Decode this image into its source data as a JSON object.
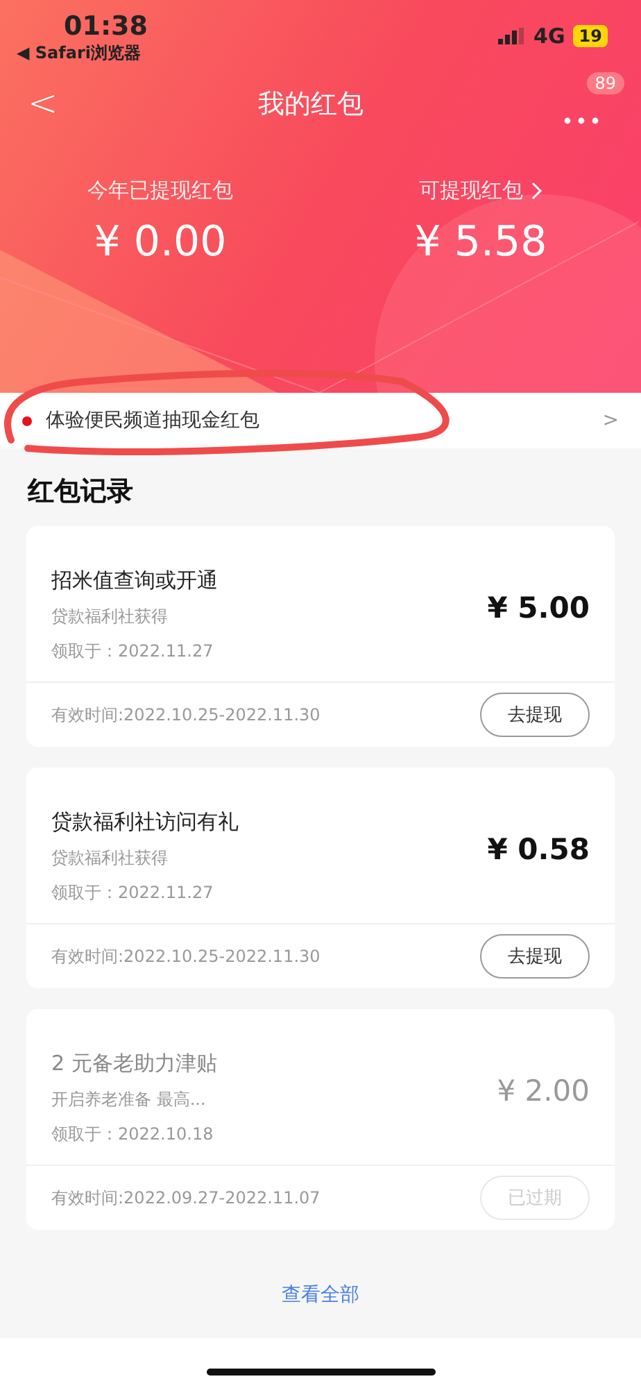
{
  "status_bar": {
    "time": "01:38",
    "back_app": "◀ Safari浏览器",
    "network": "4G",
    "battery": "19"
  },
  "nav": {
    "back": "<",
    "title": "我的红包",
    "badge": "89"
  },
  "summary": [
    {
      "label": "今年已提现红包",
      "amount": "¥ 0.00",
      "has_arrow": false
    },
    {
      "label": "可提现红包",
      "amount": "¥ 5.58",
      "has_arrow": true
    }
  ],
  "banner": {
    "text": "体验便民频道抽现金红包",
    "arrow": ">"
  },
  "section_title": "红包记录",
  "records": [
    {
      "title": "招米值查询或开通",
      "source": "贷款福利社获得",
      "received": "领取于：2022.11.27",
      "amount": "¥ 5.00",
      "validity": "有效时间:2022.10.25-2022.11.30",
      "action": "去提现",
      "expired": false
    },
    {
      "title": "贷款福利社访问有礼",
      "source": "贷款福利社获得",
      "received": "领取于：2022.11.27",
      "amount": "¥ 0.58",
      "validity": "有效时间:2022.10.25-2022.11.30",
      "action": "去提现",
      "expired": false
    },
    {
      "title": "2 元备老助力津贴",
      "source": "开启养老准备 最高...",
      "received": "领取于：2022.10.18",
      "amount": "¥ 2.00",
      "validity": "有效时间:2022.09.27-2022.11.07",
      "action": "已过期",
      "expired": true
    }
  ],
  "view_all": "查看全部"
}
